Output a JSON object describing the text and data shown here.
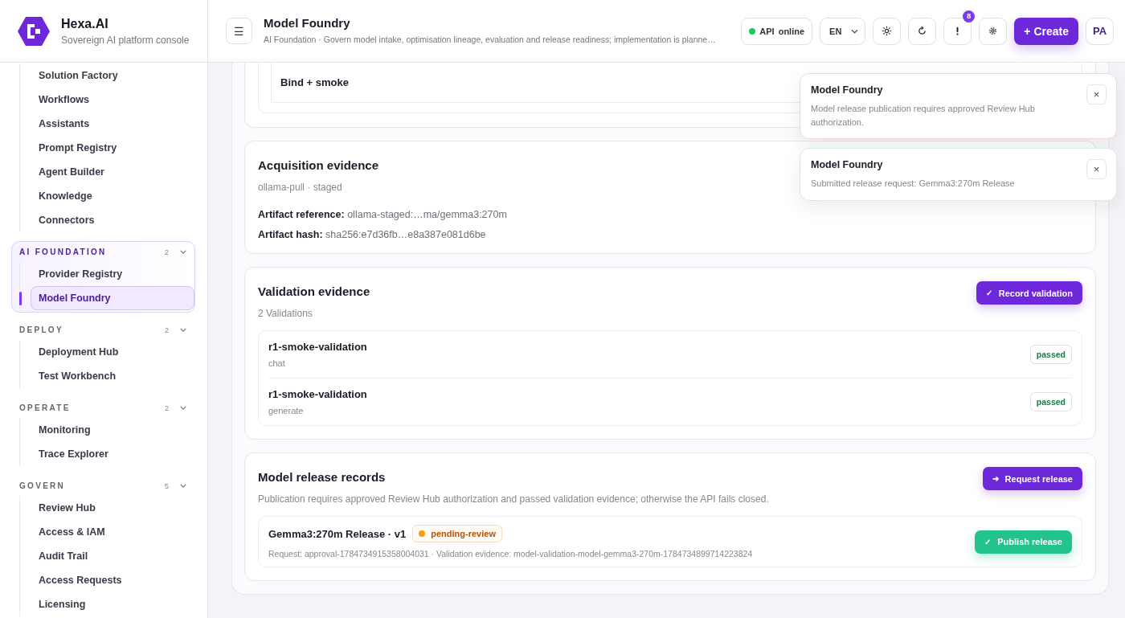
{
  "brand": {
    "name": "Hexa.AI",
    "tagline": "Sovereign AI platform console"
  },
  "sidebar": {
    "groups": [
      {
        "items": [
          {
            "label": "Solution Factory",
            "selected": false
          },
          {
            "label": "Workflows",
            "selected": false
          },
          {
            "label": "Assistants",
            "selected": false
          },
          {
            "label": "Prompt Registry",
            "selected": false
          },
          {
            "label": "Agent Builder",
            "selected": false
          },
          {
            "label": "Knowledge",
            "selected": false
          },
          {
            "label": "Connectors",
            "selected": false
          }
        ]
      },
      {
        "label": "AI FOUNDATION",
        "count": "2",
        "active": true,
        "items": [
          {
            "label": "Provider Registry",
            "selected": false
          },
          {
            "label": "Model Foundry",
            "selected": true
          }
        ]
      },
      {
        "label": "DEPLOY",
        "count": "2",
        "active": false,
        "items": [
          {
            "label": "Deployment Hub",
            "selected": false
          },
          {
            "label": "Test Workbench",
            "selected": false
          }
        ]
      },
      {
        "label": "OPERATE",
        "count": "2",
        "active": false,
        "items": [
          {
            "label": "Monitoring",
            "selected": false
          },
          {
            "label": "Trace Explorer",
            "selected": false
          }
        ]
      },
      {
        "label": "GOVERN",
        "count": "5",
        "active": false,
        "items": [
          {
            "label": "Review Hub",
            "selected": false
          },
          {
            "label": "Access & IAM",
            "selected": false
          },
          {
            "label": "Audit Trail",
            "selected": false
          },
          {
            "label": "Access Requests",
            "selected": false
          },
          {
            "label": "Licensing",
            "selected": false
          }
        ]
      }
    ]
  },
  "header": {
    "menu_glyph": "☰",
    "title": "Model Foundry",
    "subtitle": "AI Foundation · Govern model intake, optimisation lineage, evaluation and release readiness; implementation is planne…",
    "api_status": {
      "label": "API",
      "value": "online",
      "online": true
    },
    "language": "EN",
    "icon_buttons": [
      {
        "kind": "theme"
      },
      {
        "kind": "refresh"
      },
      {
        "kind": "alerts",
        "badge": "8"
      },
      {
        "kind": "settings"
      }
    ],
    "create_button": "+ Create",
    "avatar": "PA"
  },
  "pipeline_step": "Bind + smoke",
  "acquisition": {
    "title": "Acquisition evidence",
    "subtitle": "ollama-pull · staged",
    "fields": [
      {
        "label": "Artifact reference:",
        "value": "ollama-staged:…ma/gemma3:270m"
      },
      {
        "label": "Artifact hash:",
        "value": "sha256:e7d36fb…e8a387e081d6be"
      }
    ]
  },
  "validation": {
    "title": "Validation evidence",
    "subtitle": "2 Validations",
    "action": {
      "glyph": "✓",
      "label": "Record validation"
    },
    "items": [
      {
        "name": "r1-smoke-validation",
        "task": "chat",
        "result": "passed"
      },
      {
        "name": "r1-smoke-validation",
        "task": "generate",
        "result": "passed"
      }
    ]
  },
  "releases": {
    "title": "Model release records",
    "subtitle": "Publication requires approved Review Hub authorization and passed validation evidence; otherwise the API fails closed.",
    "action": {
      "glyph": "➜",
      "label": "Request release"
    },
    "records": [
      {
        "title": "Gemma3:270m Release · v1",
        "status": {
          "label": "pending-review",
          "color": "#f59e0b"
        },
        "meta": "Request: approval-1784734915358004031 · Validation evidence: model-validation-model-gemma3-270m-1784734899714223824",
        "action": {
          "glyph": "✓",
          "label": "Publish release"
        }
      }
    ]
  },
  "toasts": [
    {
      "title": "Model Foundry",
      "message": "Model release publication requires approved Review Hub authorization.",
      "kind": "error",
      "close": "×"
    },
    {
      "title": "Model Foundry",
      "message": "Submitted release request: Gemma3:270m Release",
      "kind": "success",
      "close": "×"
    }
  ]
}
